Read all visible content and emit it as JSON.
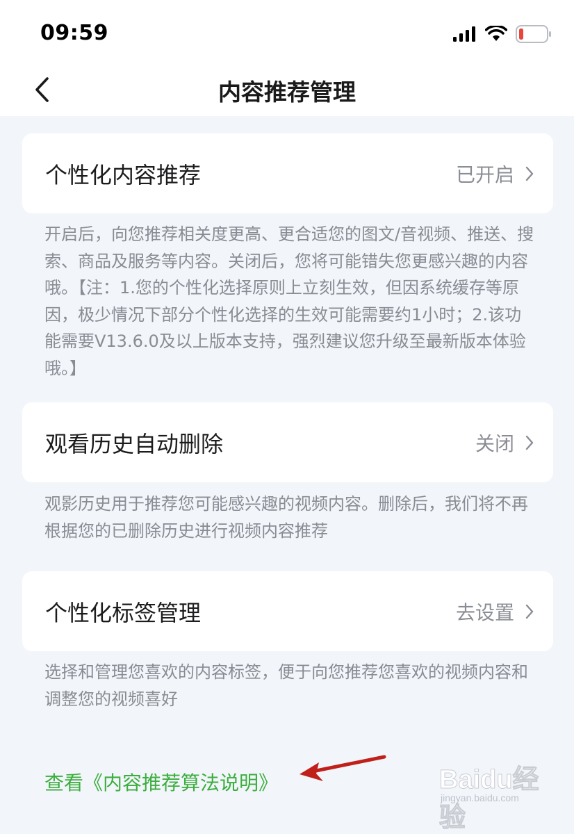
{
  "status_bar": {
    "time": "09:59",
    "battery_color": "#e8453c"
  },
  "nav": {
    "back_icon": "chevron-left-icon",
    "title": "内容推荐管理"
  },
  "settings": [
    {
      "title": "个性化内容推荐",
      "value": "已开启",
      "description": "开启后，向您推荐相关度更高、更合适您的图文/音视频、推送、搜索、商品及服务等内容。关闭后，您将可能错失您更感兴趣的内容哦。【注：1.您的个性化选择原则上立刻生效，但因系统缓存等原因，极少情况下部分个性化选择的生效可能需要约1小时；2.该功能需要V13.6.0及以上版本支持，强烈建议您升级至最新版本体验哦。】"
    },
    {
      "title": "观看历史自动删除",
      "value": "关闭",
      "description": "观影历史用于推荐您可能感兴趣的视频内容。删除后，我们将不再根据您的已删除历史进行视频内容推荐"
    },
    {
      "title": "个性化标签管理",
      "value": "去设置",
      "description": "选择和管理您喜欢的内容标签，便于向您推荐您喜欢的视频内容和调整您的视频喜好"
    }
  ],
  "footer_link": "查看《内容推荐算法说明》",
  "annotation_arrow_color": "#c0201a",
  "accent_color": "#3cae3e",
  "watermark": {
    "text": "Baidu经验",
    "sub": "jingyan.baidu.com"
  }
}
